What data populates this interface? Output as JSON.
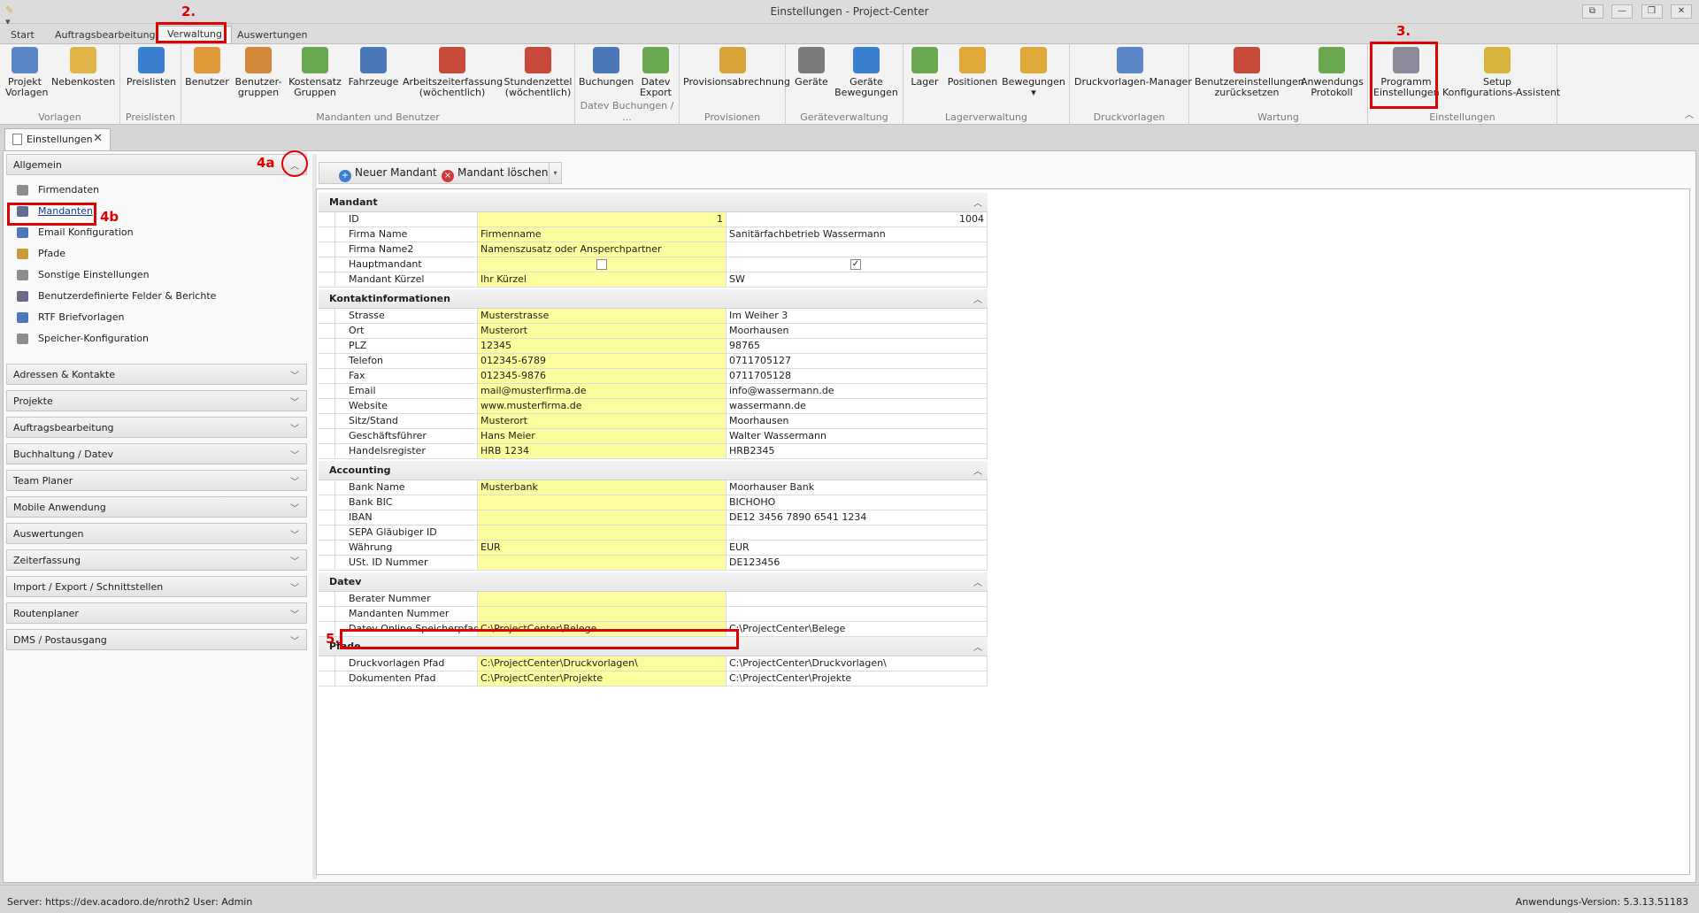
{
  "window": {
    "title": "Einstellungen - Project-Center"
  },
  "quick_access": {
    "app_icon": "pencil-icon",
    "dropdown": "▾"
  },
  "window_buttons": [
    "⧉",
    "—",
    "❐",
    "✕"
  ],
  "ribbon_tabs": [
    {
      "label": "Start"
    },
    {
      "label": "Auftragsbearbeitung"
    },
    {
      "label": "Verwaltung"
    },
    {
      "label": "Auswertungen"
    }
  ],
  "ribbon": {
    "groups": [
      {
        "label": "Vorlagen"
      },
      {
        "label": "Preislisten"
      },
      {
        "label": "Mandanten und Benutzer"
      },
      {
        "label": "Datev Buchungen / ..."
      },
      {
        "label": "Provisionen"
      },
      {
        "label": "Geräteverwaltung"
      },
      {
        "label": "Lagerverwaltung"
      },
      {
        "label": "Druckvorlagen"
      },
      {
        "label": "Wartung"
      },
      {
        "label": "Einstellungen"
      }
    ],
    "buttons": [
      {
        "l1": "Projekt",
        "l2": "Vorlagen",
        "color": "#5b86c7"
      },
      {
        "l1": "Nebenkosten",
        "l2": "",
        "color": "#e0b446"
      },
      {
        "l1": "Preislisten",
        "l2": "",
        "color": "#3a7fd0"
      },
      {
        "l1": "Benutzer",
        "l2": "",
        "color": "#e09a3a"
      },
      {
        "l1": "Benutzer-",
        "l2": "gruppen",
        "color": "#d08a3a"
      },
      {
        "l1": "Kostensatz",
        "l2": "Gruppen",
        "color": "#6aa84f"
      },
      {
        "l1": "Fahrzeuge",
        "l2": "",
        "color": "#4a78b8"
      },
      {
        "l1": "Arbeitszeiterfassung",
        "l2": "(wöchentlich)",
        "color": "#c84a3a"
      },
      {
        "l1": "Stundenzettel",
        "l2": "(wöchentlich)",
        "color": "#c84a3a"
      },
      {
        "l1": "Buchungen",
        "l2": "",
        "color": "#4a78b8"
      },
      {
        "l1": "Datev",
        "l2": "Export",
        "color": "#6aa84f"
      },
      {
        "l1": "Provisionsabrechnung",
        "l2": "",
        "color": "#d9a43a"
      },
      {
        "l1": "Geräte",
        "l2": "",
        "color": "#7a7a7a"
      },
      {
        "l1": "Geräte",
        "l2": "Bewegungen",
        "color": "#3a7fd0"
      },
      {
        "l1": "Lager",
        "l2": "",
        "color": "#6aa84f"
      },
      {
        "l1": "Positionen",
        "l2": "",
        "color": "#e0a83a"
      },
      {
        "l1": "Bewegungen",
        "l2": "▾",
        "color": "#e0a83a"
      },
      {
        "l1": "Druckvorlagen-Manager",
        "l2": "",
        "color": "#5b86c7"
      },
      {
        "l1": "Benutzereinstellungen",
        "l2": "zurücksetzen",
        "color": "#c84a3a"
      },
      {
        "l1": "Anwendungs",
        "l2": "Protokoll",
        "color": "#6aa84f"
      },
      {
        "l1": "Programm",
        "l2": "Einstellungen",
        "color": "#8a8a9a"
      },
      {
        "l1": "Setup",
        "l2": "Konfigurations-Assistent",
        "color": "#d9b43a"
      }
    ],
    "collapse_icon": "︿"
  },
  "doc_tab": {
    "label": "Einstellungen",
    "close": "✕"
  },
  "left_nav": {
    "allgemein": {
      "label": "Allgemein",
      "chevron": "︿"
    },
    "items": [
      {
        "label": "Firmendaten",
        "color": "#8c8c8c"
      },
      {
        "label": "Mandanten",
        "color": "#5e6f8f"
      },
      {
        "label": "Email Konfiguration",
        "color": "#4a78b8"
      },
      {
        "label": "Pfade",
        "color": "#c79a3a"
      },
      {
        "label": "Sonstige Einstellungen",
        "color": "#8c8c8c"
      },
      {
        "label": "Benutzerdefinierte Felder & Berichte",
        "color": "#6a6a8a"
      },
      {
        "label": "RTF Briefvorlagen",
        "color": "#4a78b8"
      },
      {
        "label": "Speicher-Konfiguration",
        "color": "#8c8c8c"
      }
    ],
    "sections": [
      {
        "label": "Adressen & Kontakte"
      },
      {
        "label": "Projekte"
      },
      {
        "label": "Auftragsbearbeitung"
      },
      {
        "label": "Buchhaltung / Datev"
      },
      {
        "label": "Team Planer"
      },
      {
        "label": "Mobile Anwendung"
      },
      {
        "label": "Auswertungen"
      },
      {
        "label": "Zeiterfassung"
      },
      {
        "label": "Import / Export / Schnittstellen"
      },
      {
        "label": "Routenplaner"
      },
      {
        "label": "DMS / Postausgang"
      }
    ],
    "chevron_down": "﹀"
  },
  "toolbar": {
    "new_label": "Neuer Mandant",
    "delete_label": "Mandant löschen",
    "dd": "▾"
  },
  "grid": {
    "collapse": "︿",
    "mandant": {
      "title": "Mandant",
      "id": {
        "label": "ID",
        "v1": "1",
        "v2": "1004"
      },
      "firma": {
        "label": "Firma Name",
        "v1": "Firmenname",
        "v2": "Sanitärfachbetrieb Wassermann"
      },
      "firma2": {
        "label": "Firma Name2",
        "v1": "Namenszusatz oder Ansperchpartner",
        "v2": ""
      },
      "haupt": {
        "label": "Hauptmandant",
        "v1": "",
        "v2": "✓"
      },
      "kuerzel": {
        "label": "Mandant Kürzel",
        "v1": "Ihr Kürzel",
        "v2": "SW"
      }
    },
    "kontakt": {
      "title": "Kontaktinformationen",
      "rows": [
        {
          "label": "Strasse",
          "v1": "Musterstrasse",
          "v2": "Im Weiher 3"
        },
        {
          "label": "Ort",
          "v1": "Musterort",
          "v2": "Moorhausen"
        },
        {
          "label": "PLZ",
          "v1": "12345",
          "v2": "98765"
        },
        {
          "label": "Telefon",
          "v1": "012345-6789",
          "v2": "0711705127"
        },
        {
          "label": "Fax",
          "v1": "012345-9876",
          "v2": "0711705128"
        },
        {
          "label": "Email",
          "v1": "mail@musterfirma.de",
          "v2": "info@wassermann.de"
        },
        {
          "label": "Website",
          "v1": "www.musterfirma.de",
          "v2": "wassermann.de"
        },
        {
          "label": "Sitz/Stand",
          "v1": "Musterort",
          "v2": "Moorhausen"
        },
        {
          "label": "Geschäftsführer",
          "v1": "Hans Meier",
          "v2": "Walter Wassermann"
        },
        {
          "label": "Handelsregister",
          "v1": "HRB 1234",
          "v2": "HRB2345"
        }
      ]
    },
    "accounting": {
      "title": "Accounting",
      "rows": [
        {
          "label": "Bank Name",
          "v1": "Musterbank",
          "v2": "Moorhauser Bank"
        },
        {
          "label": "Bank BIC",
          "v1": "",
          "v2": "BICHOHO"
        },
        {
          "label": "IBAN",
          "v1": "",
          "v2": "DE12 3456 7890 6541 1234"
        },
        {
          "label": "SEPA Gläubiger ID",
          "v1": "",
          "v2": ""
        },
        {
          "label": "Währung",
          "v1": "EUR",
          "v2": "EUR"
        },
        {
          "label": "USt. ID Nummer",
          "v1": "",
          "v2": "DE123456"
        }
      ]
    },
    "datev": {
      "title": "Datev",
      "rows": [
        {
          "label": "Berater Nummer",
          "v1": "",
          "v2": ""
        },
        {
          "label": "Mandanten Nummer",
          "v1": "",
          "v2": ""
        },
        {
          "label": "Datev Online Speicherpfad",
          "v1": "C:\\ProjectCenter\\Belege",
          "v2": "C:\\ProjectCenter\\Belege"
        }
      ]
    },
    "pfade": {
      "title": "Pfade",
      "rows": [
        {
          "label": "Druckvorlagen Pfad",
          "v1": "C:\\ProjectCenter\\Druckvorlagen\\",
          "v2": "C:\\ProjectCenter\\Druckvorlagen\\"
        },
        {
          "label": "Dokumenten Pfad",
          "v1": "C:\\ProjectCenter\\Projekte",
          "v2": "C:\\ProjectCenter\\Projekte"
        }
      ]
    }
  },
  "status": {
    "server": "Server: https://dev.acadoro.de/nroth2   User: Admin",
    "version": "Anwendungs-Version: 5.3.13.51183"
  },
  "annotations": {
    "a2": "2.",
    "a3": "3.",
    "a4a": "4a",
    "a4b": "4b",
    "a5": "5."
  },
  "colors": {
    "highlight": "#fdfd9d",
    "annotation": "#e00000"
  }
}
